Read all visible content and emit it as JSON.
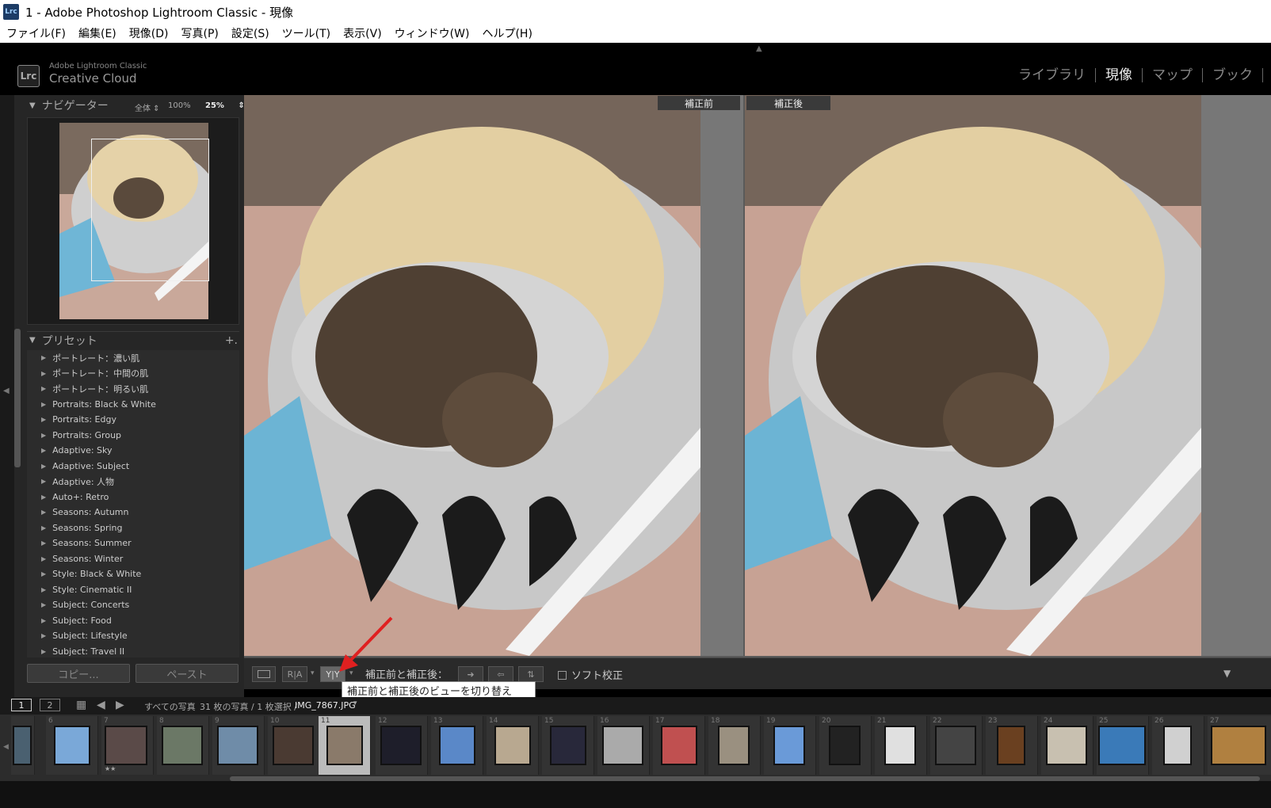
{
  "window": {
    "title": "1 - Adobe Photoshop Lightroom Classic - 現像",
    "icon": "Lrc"
  },
  "menu": [
    "ファイル(F)",
    "編集(E)",
    "現像(D)",
    "写真(P)",
    "設定(S)",
    "ツール(T)",
    "表示(V)",
    "ウィンドウ(W)",
    "ヘルプ(H)"
  ],
  "identity": {
    "badge": "Lrc",
    "line1": "Adobe Lightroom Classic",
    "line2": "Creative Cloud"
  },
  "modules": [
    {
      "label": "ライブラリ",
      "active": false
    },
    {
      "label": "現像",
      "active": true
    },
    {
      "label": "マップ",
      "active": false
    },
    {
      "label": "ブック",
      "active": false
    }
  ],
  "navigator": {
    "title": "ナビゲーター",
    "fit": "全体",
    "zoom100": "100%",
    "zoom25": "25%"
  },
  "presets": {
    "title": "プリセット",
    "add": "+.",
    "items": [
      "ポートレート：濃い肌",
      "ポートレート：中間の肌",
      "ポートレート：明るい肌",
      "Portraits: Black & White",
      "Portraits: Edgy",
      "Portraits: Group",
      "Adaptive: Sky",
      "Adaptive: Subject",
      "Adaptive: 人物",
      "Auto+: Retro",
      "Seasons: Autumn",
      "Seasons: Spring",
      "Seasons: Summer",
      "Seasons: Winter",
      "Style: Black & White",
      "Style: Cinematic II",
      "Subject: Concerts",
      "Subject: Food",
      "Subject: Lifestyle",
      "Subject: Travel II"
    ]
  },
  "buttons": {
    "copy": "コピー...",
    "paste": "ペースト"
  },
  "view": {
    "before_label": "補正前",
    "after_label": "補正後"
  },
  "toolbar": {
    "ra": "R|A",
    "yy": "Y|Y",
    "before_after": "補正前と補正後：",
    "soft_proof": "ソフト校正",
    "tooltip": "補正前と補正後のビューを切り替え"
  },
  "filmbar": {
    "page1": "1",
    "page2": "2",
    "source": "すべての写真",
    "count": "31 枚の写真 / 1 枚選択 /",
    "filename": "IMG_7867.JPG"
  },
  "filmstrip": {
    "numbers": [
      "6",
      "7",
      "8",
      "9",
      "10",
      "11",
      "12",
      "13",
      "14",
      "15",
      "16",
      "17",
      "18",
      "19",
      "20",
      "21",
      "22",
      "23",
      "24",
      "25",
      "26",
      "27"
    ],
    "selected": "11",
    "stars_under_7": "★★"
  }
}
